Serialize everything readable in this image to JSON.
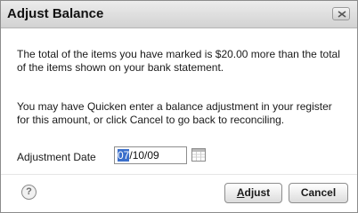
{
  "dialog": {
    "title": "Adjust Balance",
    "message_1": "The total of the items you have marked is $20.00 more than the total of the items shown on your bank statement.",
    "message_2": "You may have Quicken enter a balance adjustment in your register for this amount, or click Cancel to go back to reconciling.",
    "date_label": "Adjustment Date",
    "date_value_selected": "07",
    "date_value_rest": "/10/09",
    "adjust_first_letter": "A",
    "adjust_rest": "djust",
    "cancel_label": "Cancel",
    "help_symbol": "?"
  },
  "icons": {
    "close": "close-icon",
    "calendar": "calendar-icon",
    "help": "help-icon"
  }
}
